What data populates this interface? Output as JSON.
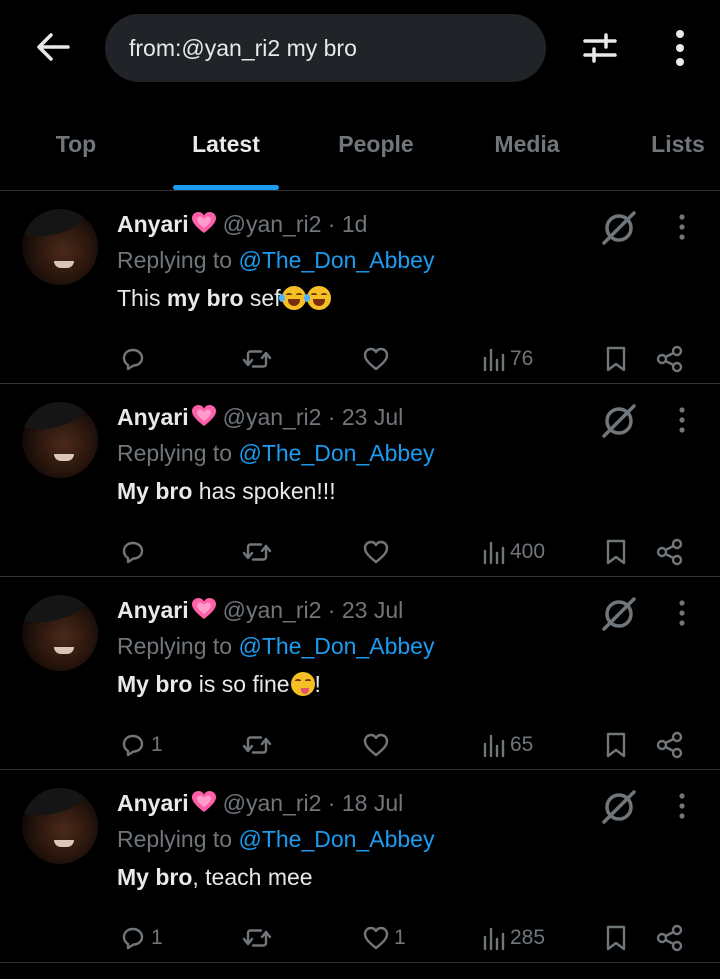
{
  "search": {
    "query": "from:@yan_ri2 my bro"
  },
  "tabs": [
    {
      "label": "Top"
    },
    {
      "label": "Latest",
      "active": true
    },
    {
      "label": "People"
    },
    {
      "label": "Media"
    },
    {
      "label": "Lists"
    }
  ],
  "colors": {
    "accent": "#1d9bf0",
    "muted": "#71767b",
    "text": "#e7e9ea",
    "background": "#000000",
    "divider": "#2f3336"
  },
  "tweets": [
    {
      "name": "Anyari",
      "handle": "@yan_ri2",
      "sep": "·",
      "time": "1d",
      "replying_prefix": "Replying to",
      "replying_to": "@The_Don_Abbey",
      "body_bold": "This",
      "body_bold2": "my bro",
      "body_rest": " sef",
      "emoji": "rofl-emoji",
      "emoji_count": 2,
      "replies": "",
      "retweets": "",
      "likes": "",
      "views": "76"
    },
    {
      "name": "Anyari",
      "handle": "@yan_ri2",
      "sep": "·",
      "time": "23 Jul",
      "replying_prefix": "Replying to",
      "replying_to": "@The_Don_Abbey",
      "body_bold": "My bro",
      "body_rest": " has spoken!!!",
      "replies": "",
      "retweets": "",
      "likes": "",
      "views": "400"
    },
    {
      "name": "Anyari",
      "handle": "@yan_ri2",
      "sep": "·",
      "time": "23 Jul",
      "replying_prefix": "Replying to",
      "replying_to": "@The_Don_Abbey",
      "body_bold": "My bro",
      "body_rest": " is so fine",
      "body_tail": "!",
      "emoji": "yum-emoji",
      "replies": "1",
      "retweets": "",
      "likes": "",
      "views": "65"
    },
    {
      "name": "Anyari",
      "handle": "@yan_ri2",
      "sep": "·",
      "time": "18 Jul",
      "replying_prefix": "Replying to",
      "replying_to": "@The_Don_Abbey",
      "body_bold": "My bro",
      "body_rest": ", teach mee",
      "replies": "1",
      "retweets": "",
      "likes": "1",
      "views": "285"
    }
  ]
}
